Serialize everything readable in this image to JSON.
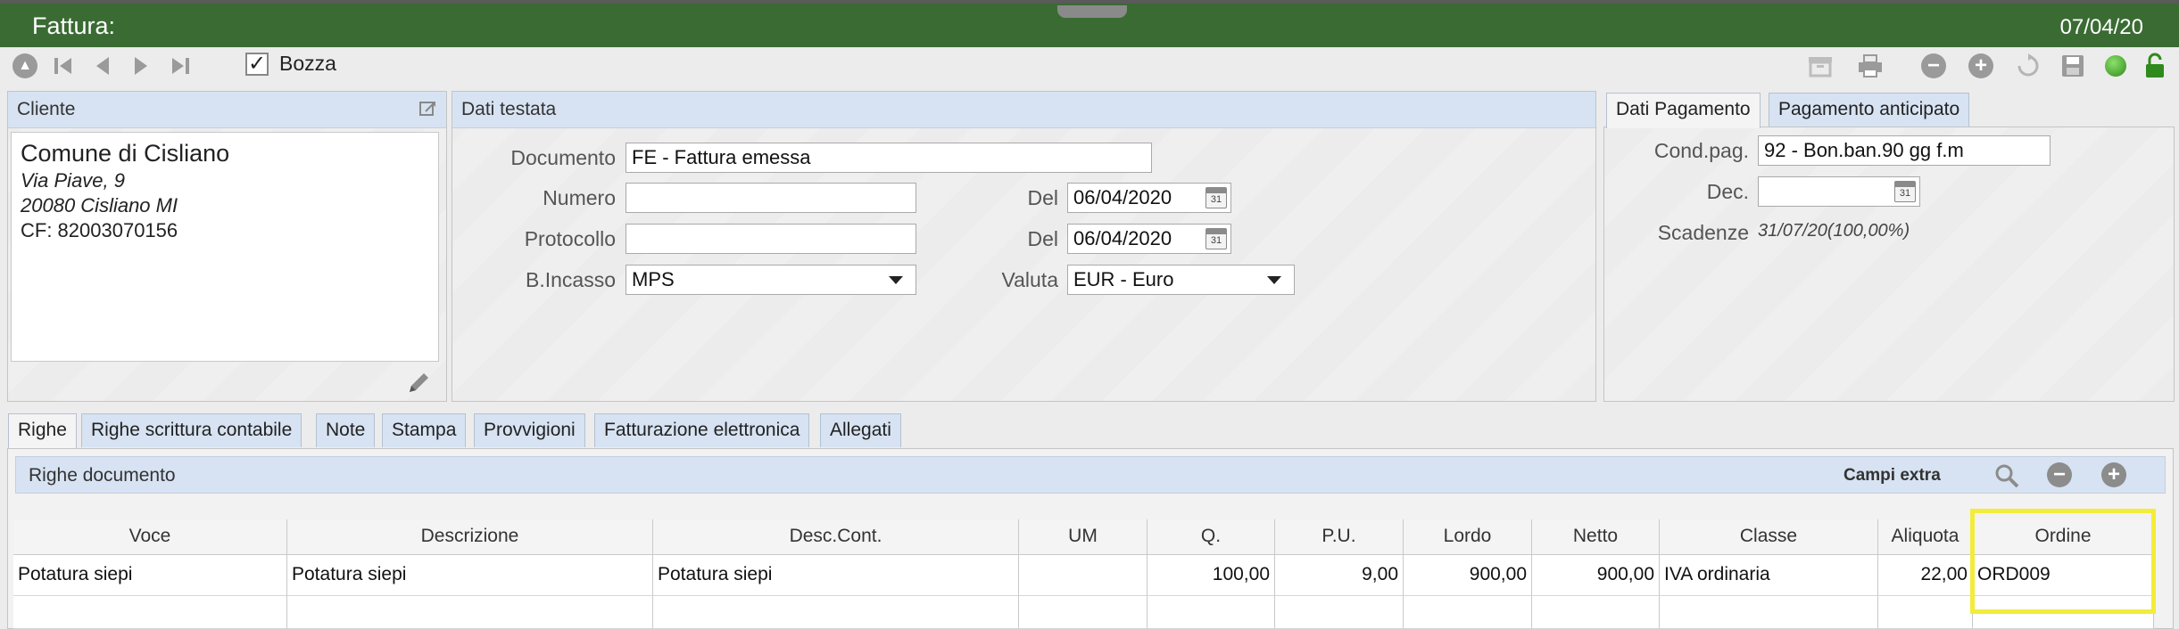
{
  "window": {
    "title": "Fattura:",
    "date": "07/04/20"
  },
  "toolbar": {
    "nav_icons": [
      "home-icon",
      "first-record-icon",
      "previous-record-icon",
      "next-record-icon",
      "last-record-icon"
    ],
    "bozza_label": "Bozza",
    "bozza_checked": true,
    "right_icons": [
      "archive-icon",
      "print-icon",
      "remove-icon",
      "add-icon",
      "refresh-icon",
      "save-icon",
      "status-icon",
      "lock-icon"
    ]
  },
  "cliente": {
    "header": "Cliente",
    "name": "Comune di Cisliano",
    "address": "Via Piave, 9",
    "city": "20080 Cisliano  MI",
    "cf": "CF: 82003070156"
  },
  "testata": {
    "header": "Dati testata",
    "documento_label": "Documento",
    "documento_value": "FE - Fattura emessa",
    "numero_label": "Numero",
    "numero_value": "",
    "del_label": "Del",
    "numero_date": "06/04/2020",
    "protocollo_label": "Protocollo",
    "protocollo_value": "",
    "protocollo_date": "06/04/2020",
    "bincasso_label": "B.Incasso",
    "bincasso_value": "MPS",
    "valuta_label": "Valuta",
    "valuta_value": "EUR - Euro"
  },
  "pagamento": {
    "tabs": [
      "Dati Pagamento",
      "Pagamento anticipato"
    ],
    "condpag_label": "Cond.pag.",
    "condpag_value": "92 - Bon.ban.90 gg f.m",
    "dec_label": "Dec.",
    "dec_value": "",
    "scadenze_label": "Scadenze",
    "scadenze_value": "31/07/20(100,00%)"
  },
  "bottom_tabs": [
    "Righe",
    "Righe scrittura contabile",
    "Note",
    "Stampa",
    "Provvigioni",
    "Fatturazione elettronica",
    "Allegati"
  ],
  "righe": {
    "header": "Righe documento",
    "campi_extra": "Campi extra",
    "columns": [
      "Voce",
      "Descrizione",
      "Desc.Cont.",
      "UM",
      "Q.",
      "P.U.",
      "Lordo",
      "Netto",
      "Classe",
      "Aliquota",
      "Ordine"
    ],
    "rows": [
      [
        "Potatura siepi",
        "Potatura siepi",
        "Potatura siepi",
        "",
        "100,00",
        "9,00",
        "900,00",
        "900,00",
        "IVA ordinaria",
        "22,00",
        "ORD009"
      ]
    ]
  },
  "colors": {
    "titlebar": "#3a6b33",
    "header_blue": "#d7e3f2",
    "highlight": "#f2ec3b"
  }
}
